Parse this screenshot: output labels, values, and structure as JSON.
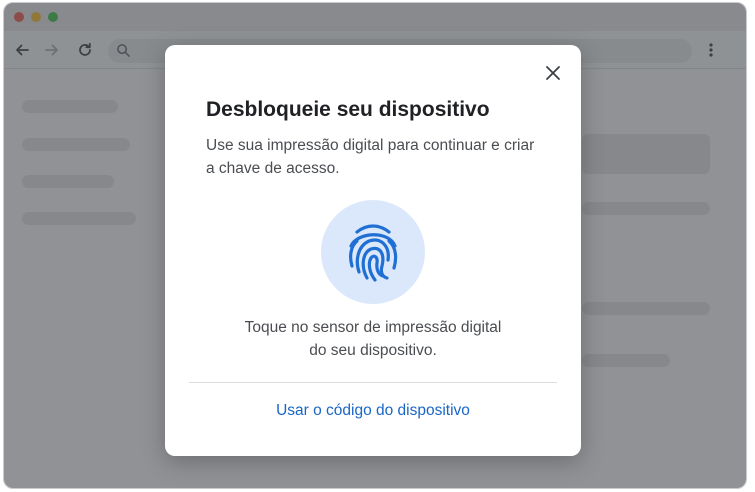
{
  "dialog": {
    "title": "Desbloqueie seu dispositivo",
    "description": "Use sua impressão digital para continuar e criar a chave de acesso.",
    "prompt_line1": "Toque no sensor de impressão digital",
    "prompt_line2": "do seu dispositivo.",
    "alt_action": "Usar o código do dispositivo",
    "close_icon": "close-icon",
    "fingerprint_icon": "fingerprint-icon"
  },
  "browser": {
    "icons": [
      "back-icon",
      "forward-icon",
      "reload-icon",
      "search-icon",
      "more-vert-icon"
    ]
  },
  "colors": {
    "accent": "#1a66c8",
    "fingerprint": "#1f6fd4",
    "fingerprint_bg": "#dbe8fb",
    "close_red": "#ee5b55",
    "minimize_yellow": "#f5bd2f",
    "zoom_green": "#3fc449"
  }
}
